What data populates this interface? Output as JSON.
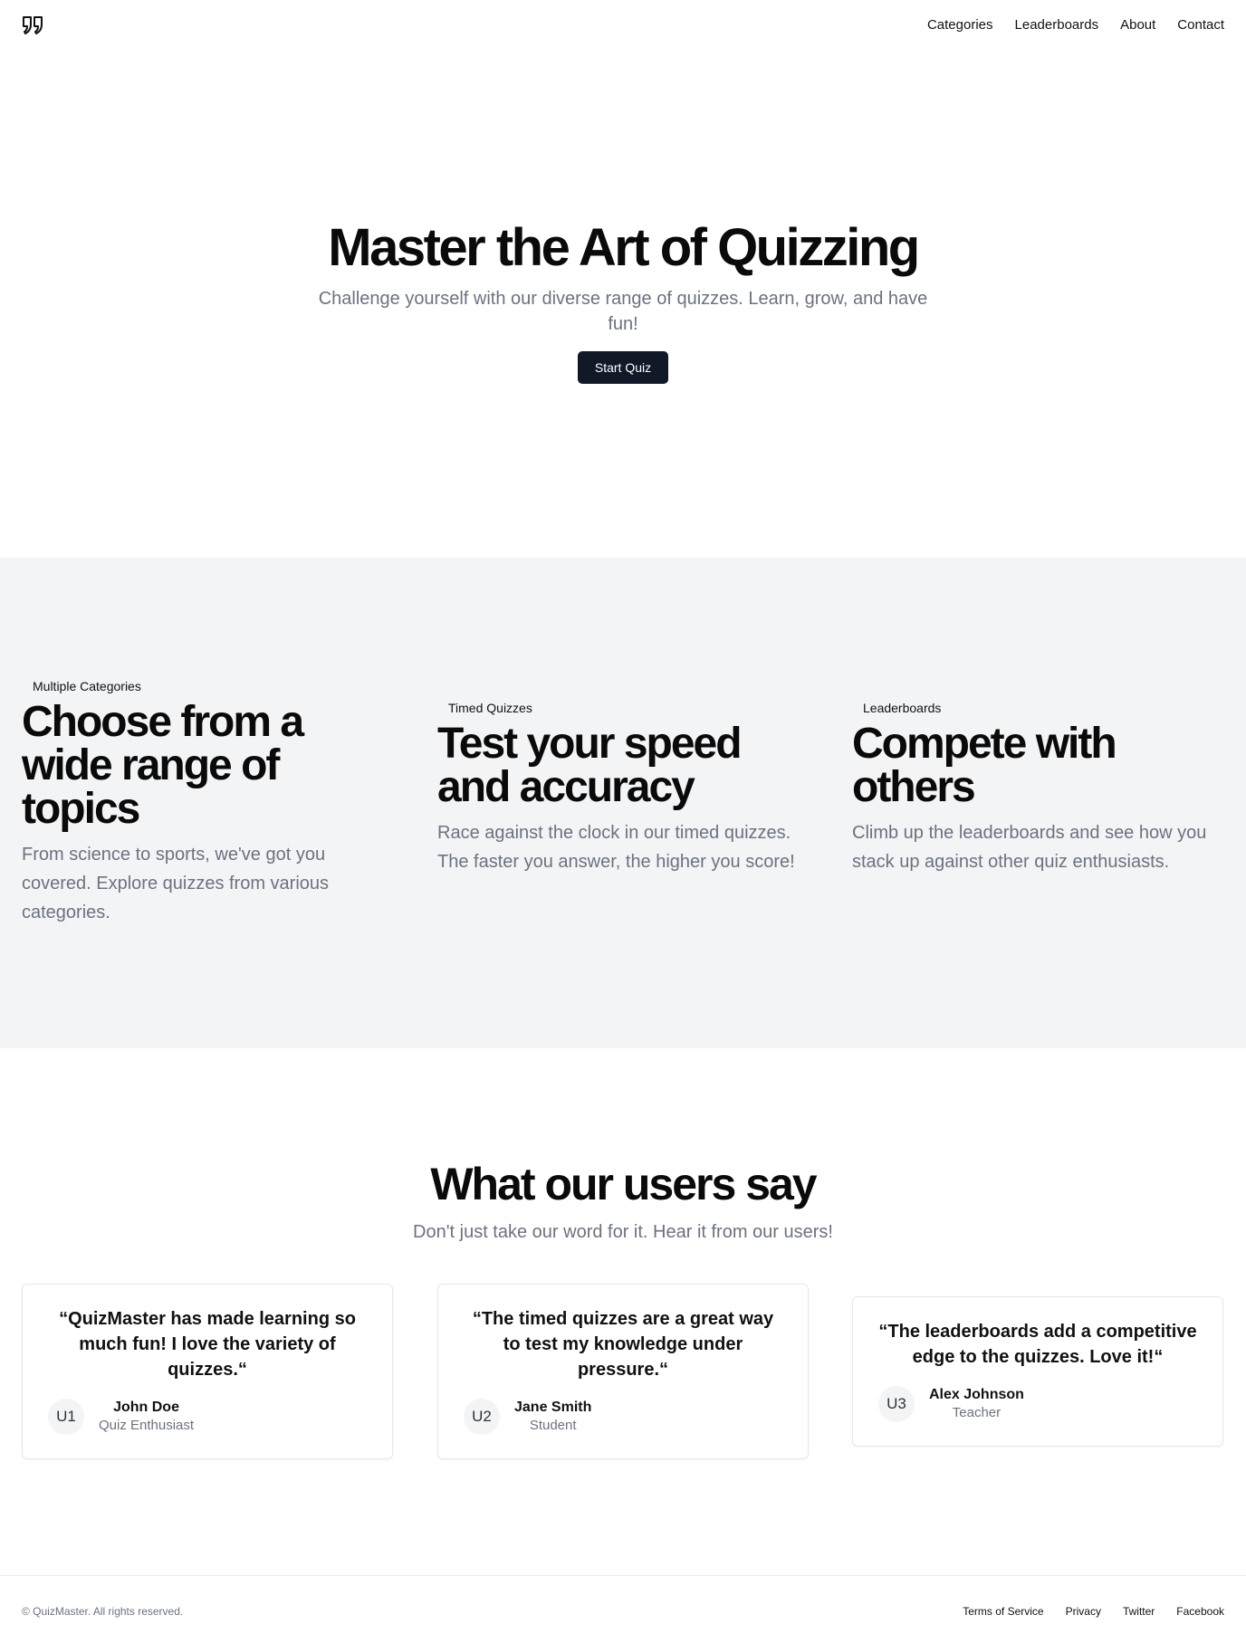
{
  "header": {
    "logo_icon": "quote-marks-icon",
    "nav": [
      "Categories",
      "Leaderboards",
      "About",
      "Contact"
    ]
  },
  "hero": {
    "title": "Master the Art of Quizzing",
    "subtitle": "Challenge yourself with our diverse range of quizzes. Learn, grow, and have fun!",
    "cta_label": "Start Quiz"
  },
  "features": [
    {
      "tag": "Multiple Categories",
      "title": "Choose from a wide range of topics",
      "description": "From science to sports, we've got you covered. Explore quizzes from various categories."
    },
    {
      "tag": "Timed Quizzes",
      "title": "Test your speed and accuracy",
      "description": "Race against the clock in our timed quizzes. The faster you answer, the higher you score!"
    },
    {
      "tag": "Leaderboards",
      "title": "Compete with others",
      "description": "Climb up the leaderboards and see how you stack up against other quiz enthusiasts."
    }
  ],
  "testimonials": {
    "title": "What our users say",
    "subtitle": "Don't just take our word for it. Hear it from our users!",
    "items": [
      {
        "quote": "“QuizMaster has made learning so much fun! I love the variety of quizzes.“",
        "avatar": "U1",
        "name": "John Doe",
        "role": "Quiz Enthusiast"
      },
      {
        "quote": "“The timed quizzes are a great way to test my knowledge under pressure.“",
        "avatar": "U2",
        "name": "Jane Smith",
        "role": "Student"
      },
      {
        "quote": "“The leaderboards add a competitive edge to the quizzes. Love it!“",
        "avatar": "U3",
        "name": "Alex Johnson",
        "role": "Teacher"
      }
    ]
  },
  "footer": {
    "copyright": "© QuizMaster. All rights reserved.",
    "links": [
      "Terms of Service",
      "Privacy",
      "Twitter",
      "Facebook"
    ]
  },
  "colors": {
    "primary_button": "#111827",
    "muted_text": "#6b7280",
    "section_bg": "#f3f4f6"
  }
}
